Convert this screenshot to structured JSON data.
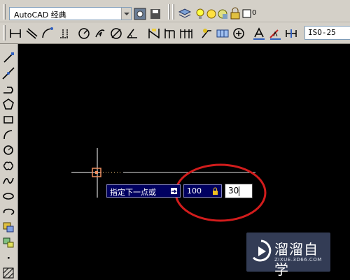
{
  "toolbar": {
    "workspace_value": "AutoCAD 经典",
    "layer_value": "0",
    "dimstyle_value": "ISO-25"
  },
  "dynamic_input": {
    "prompt": "指定下一点或",
    "distance": "100",
    "angle": "30"
  },
  "watermark": {
    "name": "溜溜自学",
    "url": "ZIXUE.3D66.COM"
  },
  "colors": {
    "toolbar_bg": "#d4d0c8",
    "canvas_bg": "#000000",
    "prompt_bg": "#000060",
    "annotation_circle": "#d21c1c"
  }
}
